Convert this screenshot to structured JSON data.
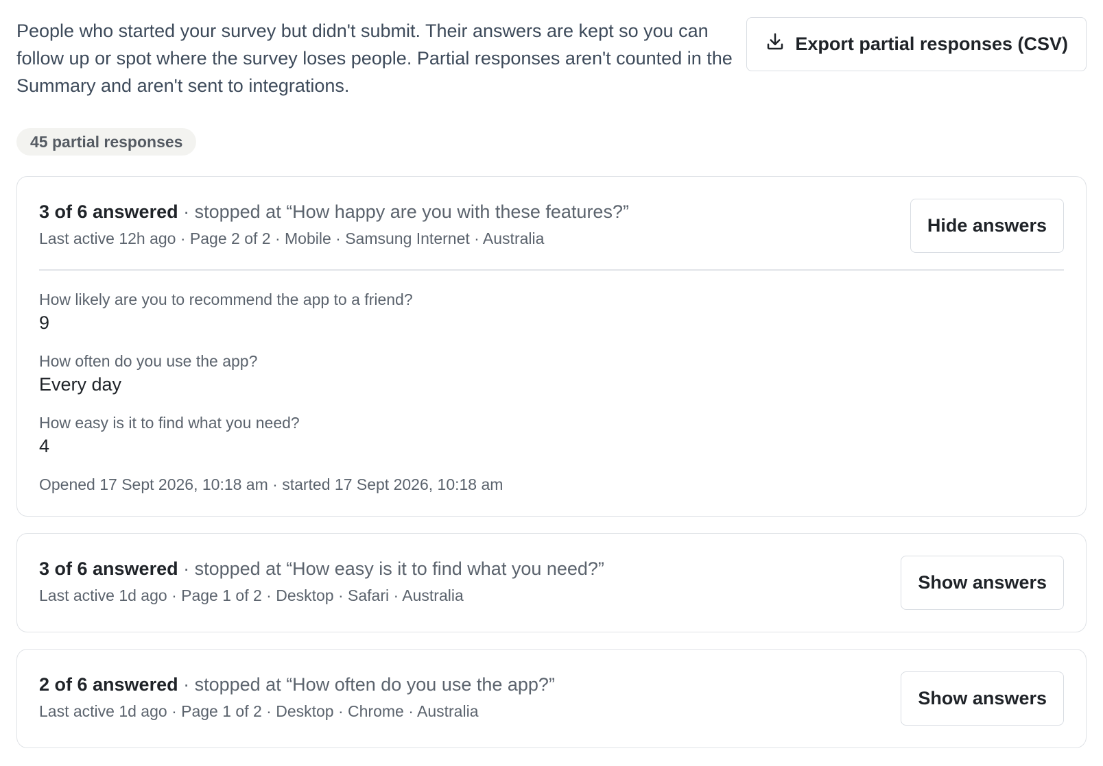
{
  "intro": {
    "text": "People who started your survey but didn't submit. Their answers are kept so you can follow up or spot where the survey loses people. Partial responses aren't counted in the Summary and aren't sent to integrations."
  },
  "toolbar": {
    "export_label": "Export partial responses (CSV)",
    "export_icon": "download-icon"
  },
  "count": {
    "label": "45 partial responses"
  },
  "responses": [
    {
      "answered": "3 of 6 answered",
      "stopped": " · stopped at “How happy are you with these features?”",
      "meta": "Last active 12h ago · Page 2 of 2 · Mobile · Samsung Internet · Australia",
      "toggle_label": "Hide answers",
      "answers": [
        {
          "question": "How likely are you to recommend the app to a friend?",
          "answer": "9"
        },
        {
          "question": "How often do you use the app?",
          "answer": "Every day"
        },
        {
          "question": "How easy is it to find what you need?",
          "answer": "4"
        }
      ],
      "timestamps": "Opened 17 Sept 2026, 10:18 am · started 17 Sept 2026, 10:18 am"
    },
    {
      "answered": "3 of 6 answered",
      "stopped": " · stopped at “How easy is it to find what you need?”",
      "meta": "Last active 1d ago · Page 1 of 2 · Desktop · Safari · Australia",
      "toggle_label": "Show answers"
    },
    {
      "answered": "2 of 6 answered",
      "stopped": " · stopped at “How often do you use the app?”",
      "meta": "Last active 1d ago · Page 1 of 2 · Desktop · Chrome · Australia",
      "toggle_label": "Show answers"
    }
  ]
}
